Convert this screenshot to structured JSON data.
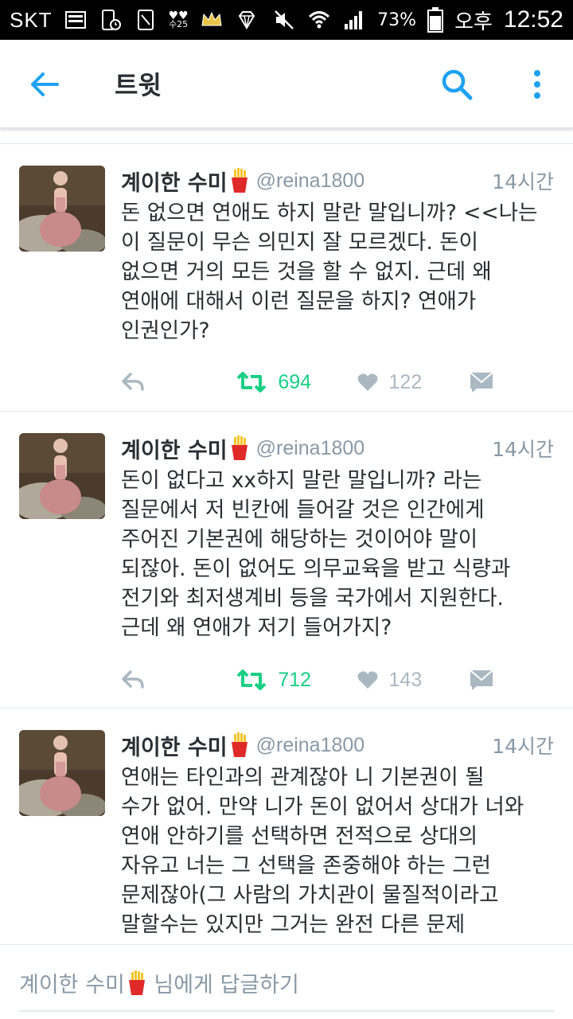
{
  "status_bar": {
    "carrier": "SKT",
    "date_badge": "수25",
    "battery": "73%",
    "ampm": "오후",
    "time": "12:52"
  },
  "app_bar": {
    "title": "트윗",
    "icons": [
      "back-arrow-icon",
      "search-icon",
      "more-vert-icon"
    ]
  },
  "colors": {
    "accent": "#1da1f2",
    "retweet": "#19cf86",
    "secondary_text": "#8899a6",
    "icon_gray": "#aab8c2"
  },
  "tweets": [
    {
      "name": "계이한 수미",
      "handle": "@reina1800",
      "time": "14시간",
      "text": "돈 없으면 연애도 하지 말란 말입니까? <<나는\n이 질문이 무슨 의민지 잘 모르겠다. 돈이\n없으면 거의 모든 것을 할 수 없지. 근데 왜\n연애에 대해서 이런 질문을 하지? 연애가\n인권인가?",
      "retweets": "694",
      "likes": "122"
    },
    {
      "name": "계이한 수미",
      "handle": "@reina1800",
      "time": "14시간",
      "text": "돈이 없다고 xx하지 말란 말입니까? 라는\n질문에서 저 빈칸에 들어갈 것은 인간에게\n주어진 기본권에 해당하는 것이어야 말이\n되잖아. 돈이 없어도 의무교육을 받고 식량과\n전기와 최저생계비 등을 국가에서 지원한다.\n근데 왜 연애가 저기 들어가지?",
      "retweets": "712",
      "likes": "143"
    },
    {
      "name": "계이한 수미",
      "handle": "@reina1800",
      "time": "14시간",
      "text": "연애는 타인과의 관계잖아 니 기본권이 될\n수가 없어. 만약 니가 돈이 없어서 상대가 너와\n연애 안하기를 선택하면 전적으로 상대의\n자유고 너는 그 선택을 존중해야 하는 그런\n문제잖아(그 사람의 가치관이 물질적이라고\n말할수는 있지만 그거는 완전 다른 문제"
    }
  ],
  "reply_bar": {
    "name": "계이한 수미",
    "suffix": " 님에게 답글하기"
  }
}
